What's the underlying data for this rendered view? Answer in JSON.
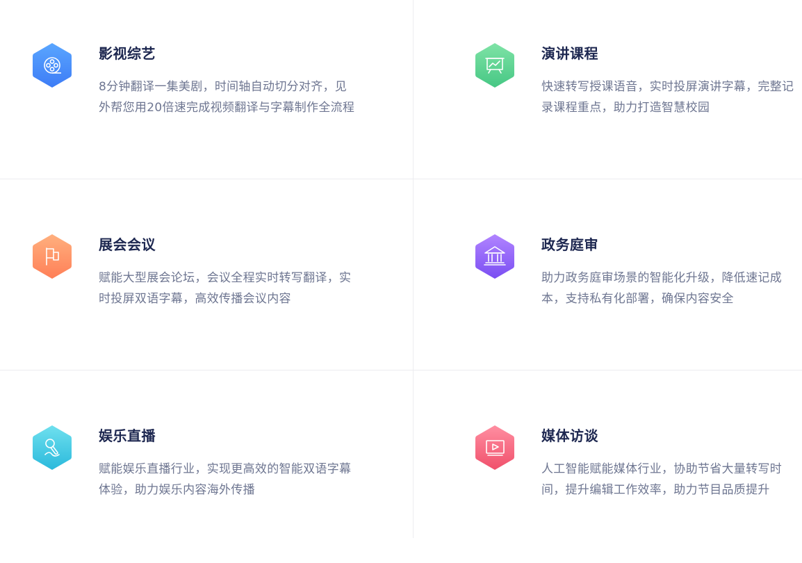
{
  "cards": [
    {
      "title": "影视综艺",
      "desc": "8分钟翻译一集美剧，时间轴自动切分对齐，见外帮您用20倍速完成视频翻译与字幕制作全流程",
      "icon": "film-reel-icon",
      "color_top": "#5aa6ff",
      "color_bottom": "#3d7cf6"
    },
    {
      "title": "演讲课程",
      "desc": "快速转写授课语音，实时投屏演讲字幕，完整记录课程重点，助力打造智慧校园",
      "icon": "presentation-board-icon",
      "color_top": "#7fe3a6",
      "color_bottom": "#46c784"
    },
    {
      "title": "展会会议",
      "desc": "赋能大型展会论坛，会议全程实时转写翻译，实时投屏双语字幕，高效传播会议内容",
      "icon": "flag-icon",
      "color_top": "#ffb07e",
      "color_bottom": "#ff7f57"
    },
    {
      "title": "政务庭审",
      "desc": "助力政务庭审场景的智能化升级，降低速记成本，支持私有化部署，确保内容安全",
      "icon": "government-building-icon",
      "color_top": "#b184ff",
      "color_bottom": "#7a4ef2"
    },
    {
      "title": "娱乐直播",
      "desc": "赋能娱乐直播行业，实现更高效的智能双语字幕体验，助力娱乐内容海外传播",
      "icon": "microphone-icon",
      "color_top": "#6fe0ee",
      "color_bottom": "#2ab9dc"
    },
    {
      "title": "媒体访谈",
      "desc": "人工智能赋能媒体行业，协助节省大量转写时间，提升编辑工作效率，助力节目品质提升",
      "icon": "video-play-icon",
      "color_top": "#ff8ea1",
      "color_bottom": "#f0506b"
    }
  ]
}
